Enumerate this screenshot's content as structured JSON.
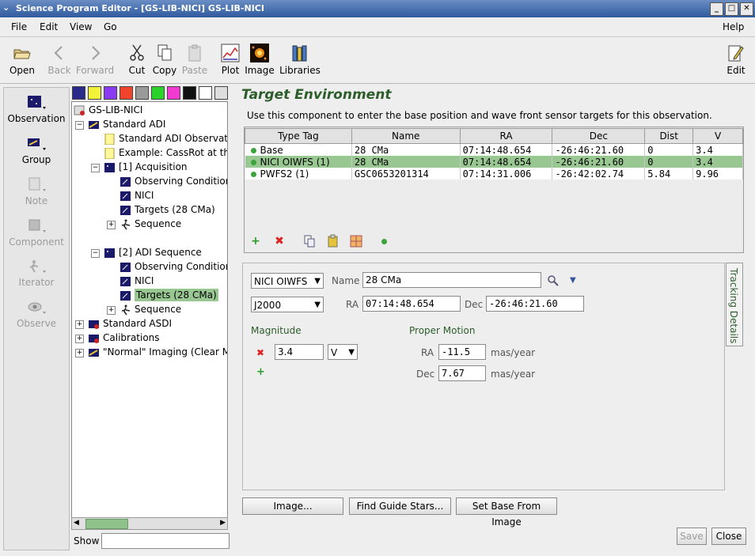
{
  "window": {
    "title": "Science Program Editor - [GS-LIB-NICI] GS-LIB-NICI"
  },
  "menu": {
    "items": [
      "File",
      "Edit",
      "View",
      "Go"
    ],
    "help": "Help"
  },
  "toolbar": {
    "open": "Open",
    "back": "Back",
    "forward": "Forward",
    "cut": "Cut",
    "copy": "Copy",
    "paste": "Paste",
    "plot": "Plot",
    "image": "Image",
    "libraries": "Libraries",
    "edit": "Edit"
  },
  "palette": {
    "observation": "Observation",
    "group": "Group",
    "note": "Note",
    "component": "Component",
    "iterator": "Iterator",
    "observe": "Observe"
  },
  "tree": {
    "root": "GS-LIB-NICI",
    "n1": "Standard ADI",
    "n2": "Standard ADI Observati",
    "n3": "Example: CassRot at th",
    "n4": "[1] Acquisition",
    "n5": "Observing Condition",
    "n6": "NICI",
    "n7": "Targets (28 CMa)",
    "n8": "Sequence",
    "n9": "[2] ADI Sequence",
    "n10": "Observing Condition",
    "n11": "NICI",
    "n12": "Targets (28 CMa)",
    "n13": "Sequence",
    "n14": "Standard ASDI",
    "n15": "Calibrations",
    "n16": "\"Normal\" Imaging (Clear Ma",
    "show_label": "Show"
  },
  "main": {
    "heading": "Target Environment",
    "description": "Use this component to enter the base position and wave front sensor targets for this observation."
  },
  "table": {
    "headers": [
      "Type Tag",
      "Name",
      "RA",
      "Dec",
      "Dist",
      "V"
    ],
    "rows": [
      {
        "tag": "Base",
        "name": "28 CMa",
        "ra": "07:14:48.654",
        "dec": "-26:46:21.60",
        "dist": "0",
        "v": "3.4"
      },
      {
        "tag": "NICI OIWFS (1)",
        "name": "28 CMa",
        "ra": "07:14:48.654",
        "dec": "-26:46:21.60",
        "dist": "0",
        "v": "3.4"
      },
      {
        "tag": "PWFS2 (1)",
        "name": "GSC0653201314",
        "ra": "07:14:31.006",
        "dec": "-26:42:02.74",
        "dist": "5.84",
        "v": "9.96"
      }
    ]
  },
  "detail": {
    "type_value": "NICI OIWFS",
    "name_label": "Name",
    "name_value": "28 CMa",
    "coord_system": "J2000",
    "ra_label": "RA",
    "ra_value": "07:14:48.654",
    "dec_label": "Dec",
    "dec_value": "-26:46:21.60",
    "magnitude_label": "Magnitude",
    "mag_value": "3.4",
    "mag_band": "V",
    "proper_motion_label": "Proper Motion",
    "pm_ra_label": "RA",
    "pm_ra_value": "-11.5",
    "pm_ra_unit": "mas/year",
    "pm_dec_label": "Dec",
    "pm_dec_value": "7.67",
    "pm_dec_unit": "mas/year",
    "side_tab": "Tracking Details"
  },
  "buttons": {
    "image": "Image...",
    "find_guide_stars": "Find Guide Stars...",
    "set_base": "Set Base From Image",
    "save": "Save",
    "close": "Close"
  },
  "colors": {
    "selected": "#99c792",
    "heading": "#2c5d2a",
    "status_dot": "#3ba33b"
  }
}
